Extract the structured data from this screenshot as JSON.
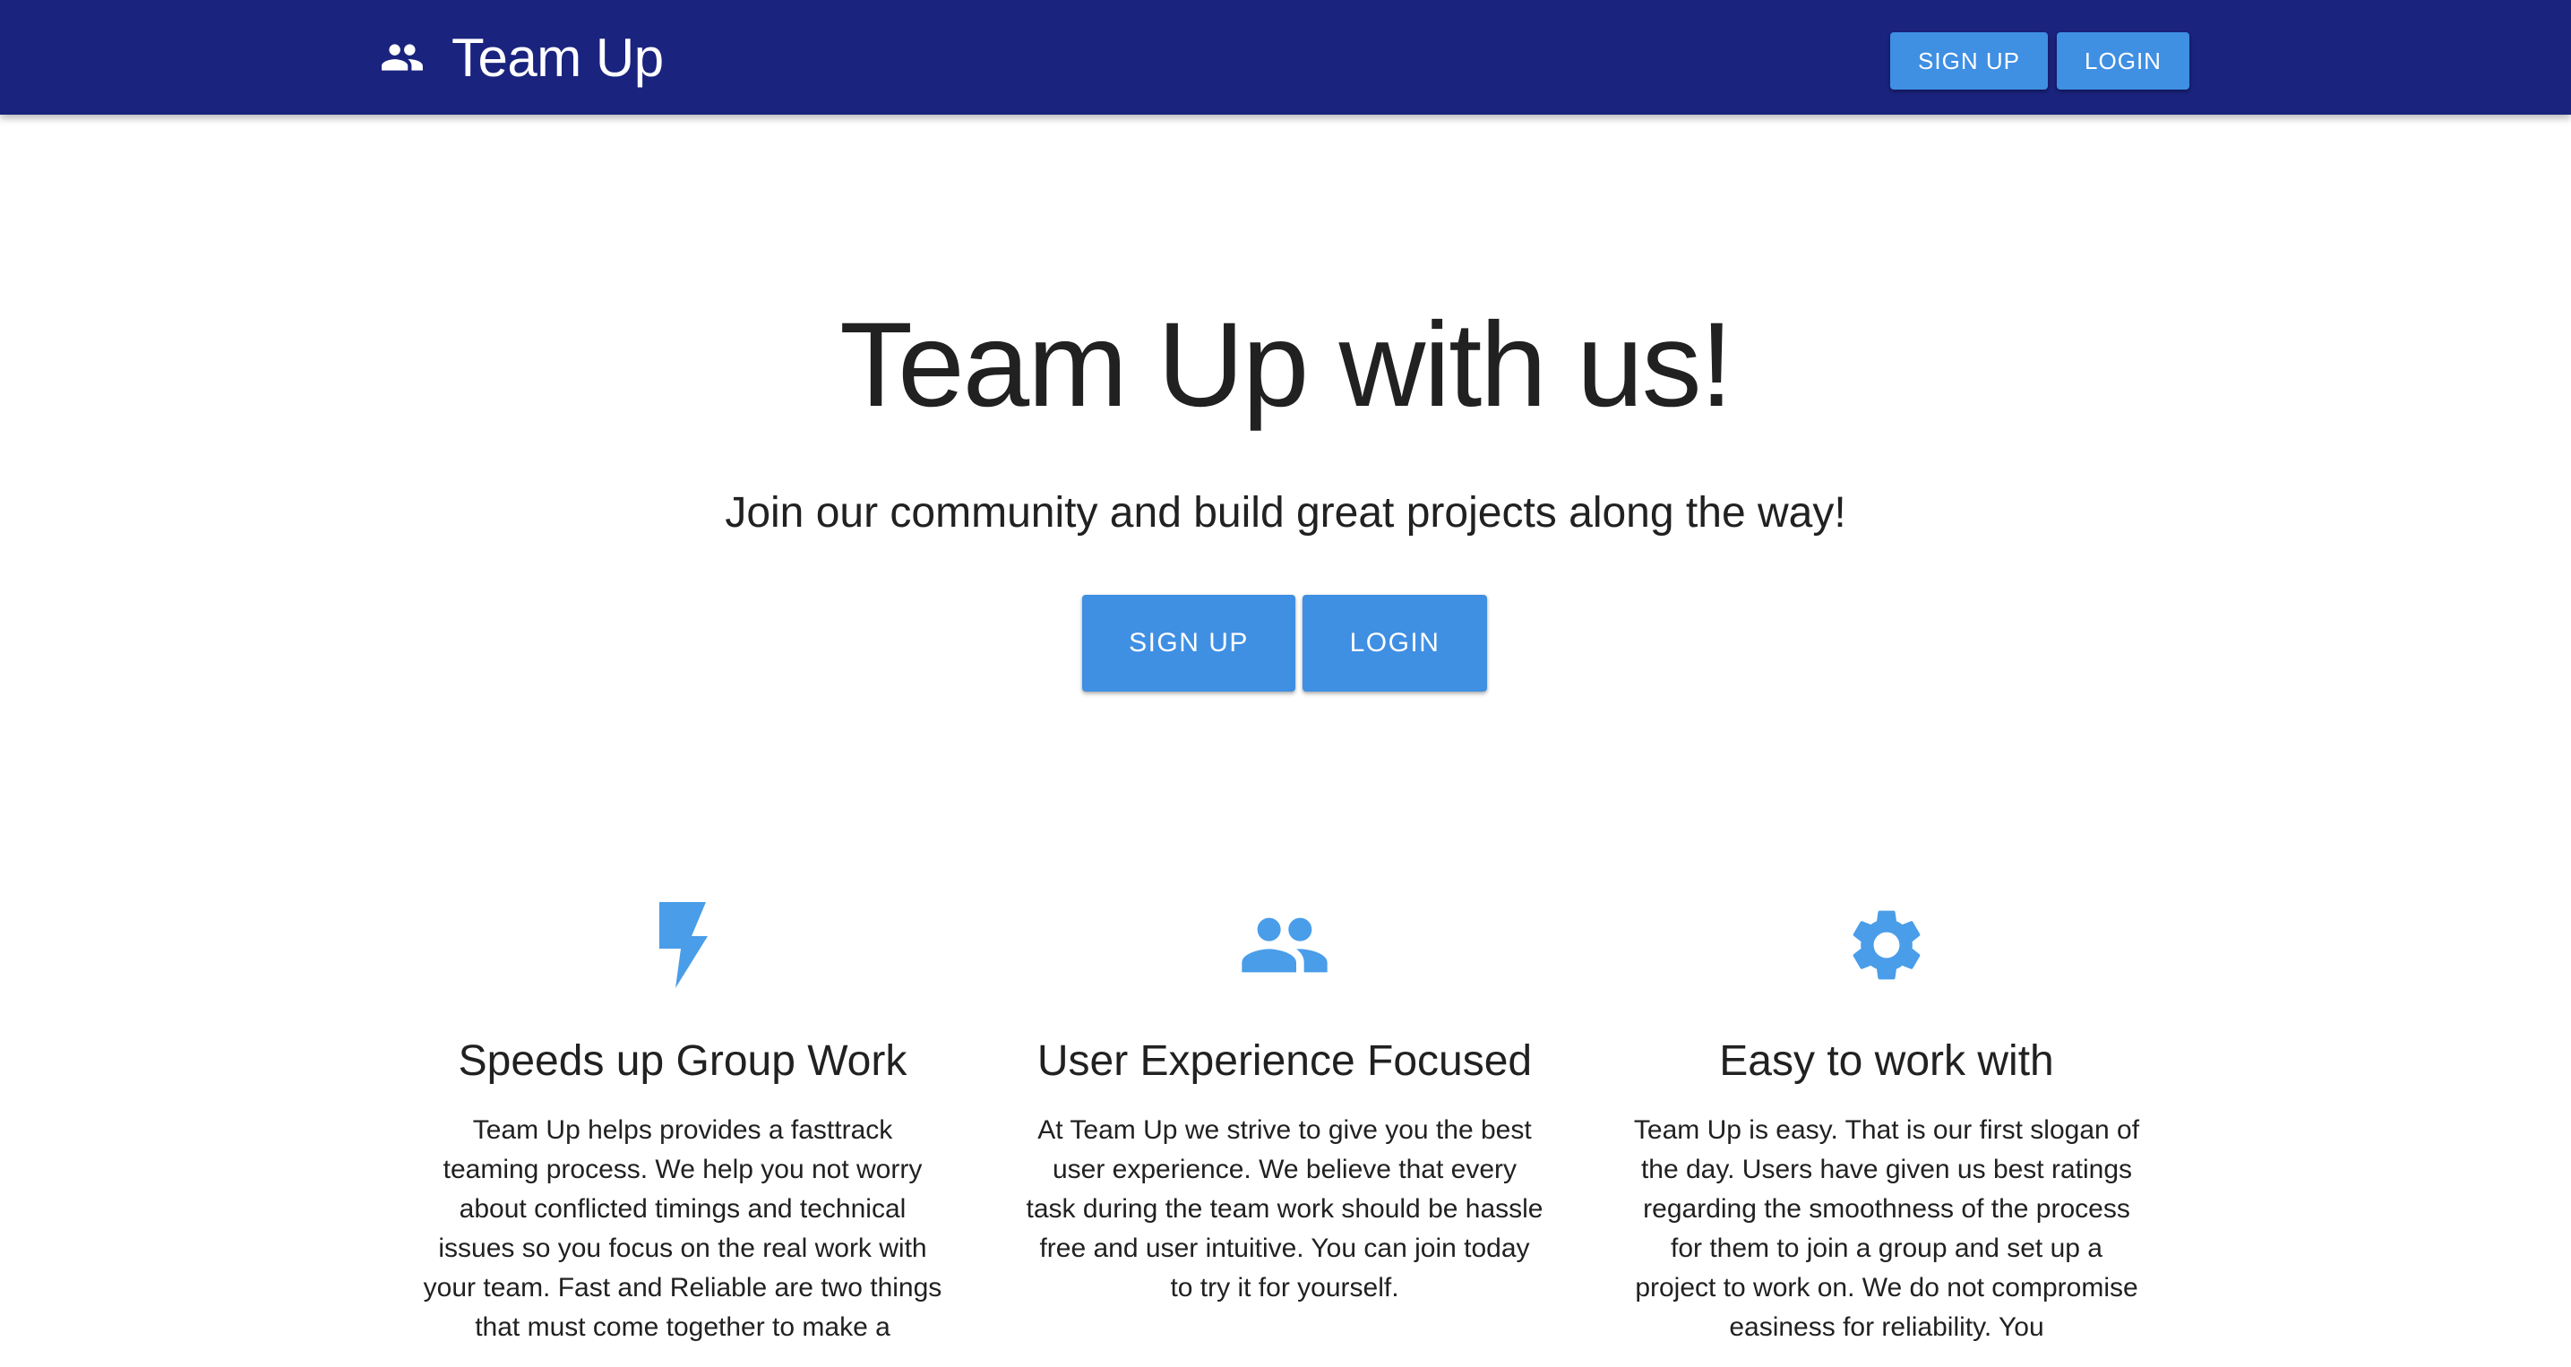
{
  "header": {
    "icon": "people-icon",
    "title": "Team Up",
    "signup_label": "SIGN UP",
    "login_label": "LOGIN",
    "background": "#1a237e"
  },
  "hero": {
    "title": "Team Up with us!",
    "subtitle": "Join our community and build great projects along the way!",
    "signup_label": "SIGN UP",
    "login_label": "LOGIN"
  },
  "features": [
    {
      "icon": "lightning-bolt-icon",
      "title": "Speeds up Group Work",
      "text": "Team Up helps provides a fasttrack teaming process. We help you not worry about conflicted timings and technical issues so you focus on the real work with your team. Fast and Reliable are two things that must come together to make a"
    },
    {
      "icon": "people-icon",
      "title": "User Experience Focused",
      "text": "At Team Up we strive to give you the best user experience. We believe that every task during the team work should be hassle free and user intuitive. You can join today to try it for yourself."
    },
    {
      "icon": "gear-icon",
      "title": "Easy to work with",
      "text": "Team Up is easy. That is our first slogan of the day. Users have given us best ratings regarding the smoothness of the process for them to join a group and set up a project to work on. We do not compromise easiness for reliability. You"
    }
  ],
  "colors": {
    "appbar": "#1a237e",
    "accent": "#3f8fe3",
    "icon": "#4a9de8",
    "text": "#212121"
  }
}
